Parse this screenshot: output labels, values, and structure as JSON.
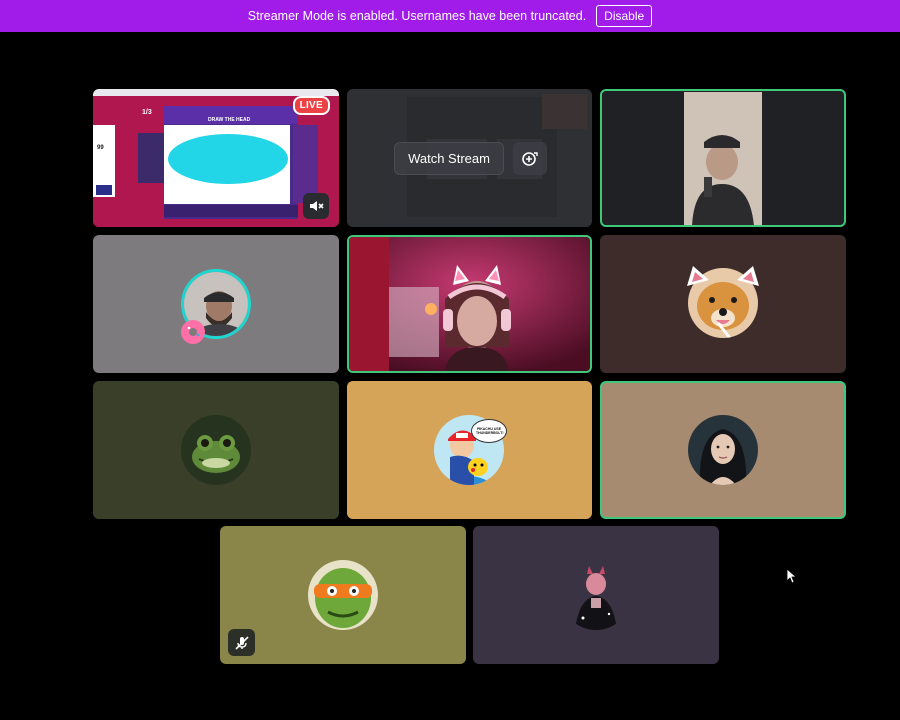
{
  "banner": {
    "message": "Streamer Mode is enabled. Usernames have been truncated.",
    "disable_label": "Disable"
  },
  "stream_tile": {
    "live_badge": "LIVE",
    "game_round": "1/3",
    "game_prompt": "DRAW THE HEAD",
    "side_score": "99"
  },
  "watch_tile": {
    "watch_label": "Watch Stream"
  },
  "participants": [
    {
      "tile": "webcam-man-cap",
      "speaking": true
    },
    {
      "tile": "pixel-avatar",
      "speaking": false
    },
    {
      "tile": "webcam-cat-headset",
      "speaking": true
    },
    {
      "tile": "dog-avatar",
      "speaking": false
    },
    {
      "tile": "frog-avatar",
      "speaking": false
    },
    {
      "tile": "pokemon-avatar",
      "speaking": false
    },
    {
      "tile": "woman-avatar",
      "speaking": true
    },
    {
      "tile": "turtle-avatar",
      "speaking": false,
      "muted": true
    },
    {
      "tile": "devil-avatar",
      "speaking": false
    }
  ],
  "pokemon_speech_bubble": "PIKACHU USE THUNDERBOLT!",
  "colors": {
    "banner": "#a11ce8",
    "speaking_border": "#3fc77a",
    "live_red": "#ed4245"
  }
}
